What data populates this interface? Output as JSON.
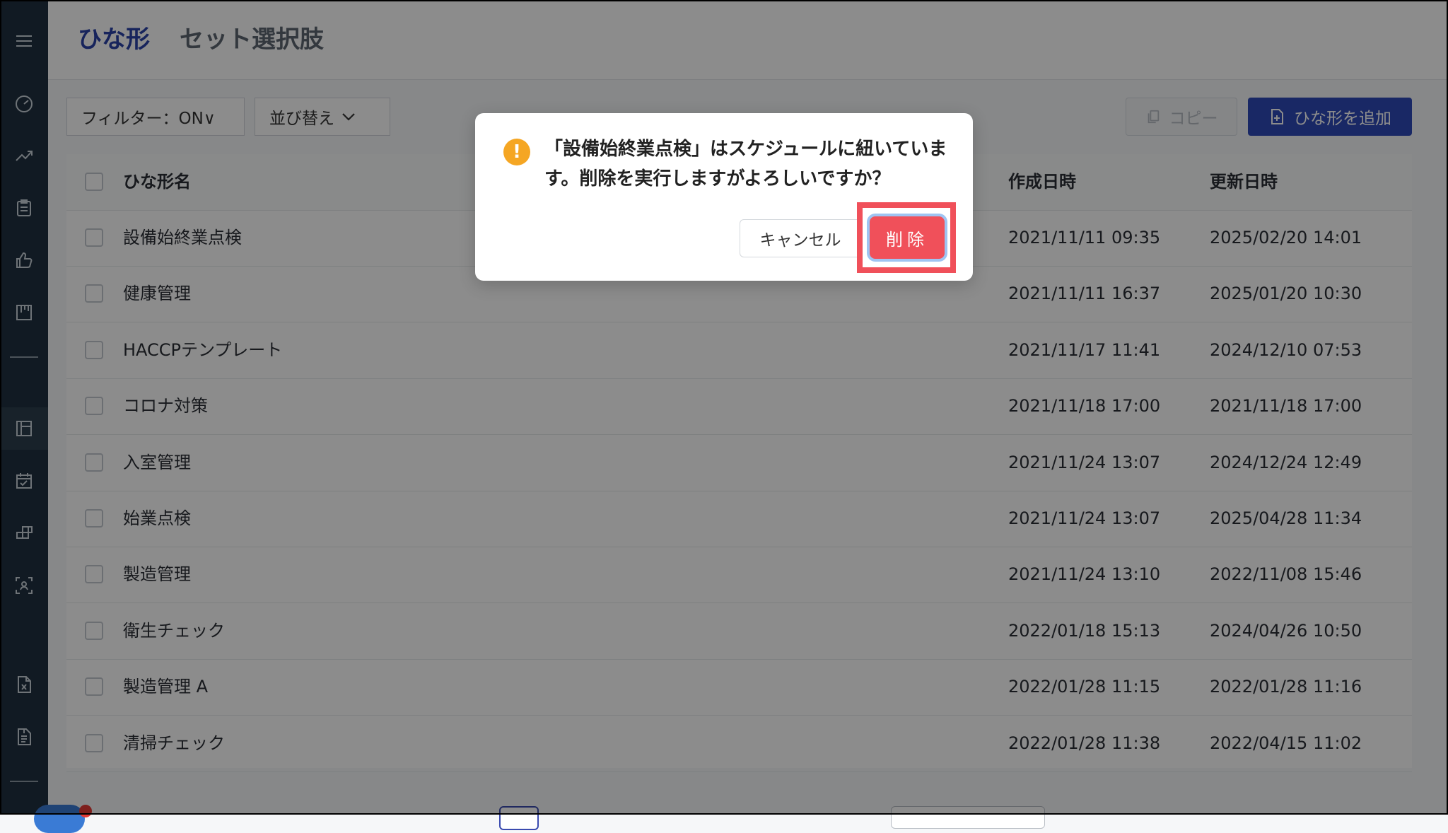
{
  "header": {
    "tabs": [
      {
        "label": "ひな形",
        "active": true
      },
      {
        "label": "セット選択肢",
        "active": false
      }
    ]
  },
  "toolbar": {
    "filter_label": "フィルター：ON∨",
    "sort_label": "並び替え",
    "copy_label": "コピー",
    "add_label": "ひな形を追加"
  },
  "table": {
    "columns": {
      "name": "ひな形名",
      "created": "作成日時",
      "updated": "更新日時"
    },
    "rows": [
      {
        "name": "設備始終業点検",
        "created": "2021/11/11 09:35",
        "updated": "2025/02/20 14:01"
      },
      {
        "name": "健康管理",
        "created": "2021/11/11 16:37",
        "updated": "2025/01/20 10:30"
      },
      {
        "name": "HACCPテンプレート",
        "created": "2021/11/17 11:41",
        "updated": "2024/12/10 07:53"
      },
      {
        "name": "コロナ対策",
        "created": "2021/11/18 17:00",
        "updated": "2021/11/18 17:00"
      },
      {
        "name": "入室管理",
        "created": "2021/11/24 13:07",
        "updated": "2024/12/24 12:49"
      },
      {
        "name": "始業点検",
        "created": "2021/11/24 13:07",
        "updated": "2025/04/28 11:34"
      },
      {
        "name": "製造管理",
        "created": "2021/11/24 13:10",
        "updated": "2022/11/08 15:46"
      },
      {
        "name": "衛生チェック",
        "created": "2022/01/18 15:13",
        "updated": "2024/04/26 10:50"
      },
      {
        "name": "製造管理 A",
        "created": "2022/01/28 11:15",
        "updated": "2022/01/28 11:16"
      },
      {
        "name": "清掃チェック",
        "created": "2022/01/28 11:38",
        "updated": "2022/04/15 11:02"
      }
    ]
  },
  "dialog": {
    "message": "「設備始終業点検」はスケジュールに紐いています。削除を実行しますがよろしいですか？",
    "cancel_label": "キャンセル",
    "delete_label": "削除",
    "icon_glyph": "!"
  },
  "colors": {
    "sidebar": "#1f3140",
    "accent": "#2e4ab8",
    "danger": "#f0505a",
    "warning": "#f5a623"
  }
}
